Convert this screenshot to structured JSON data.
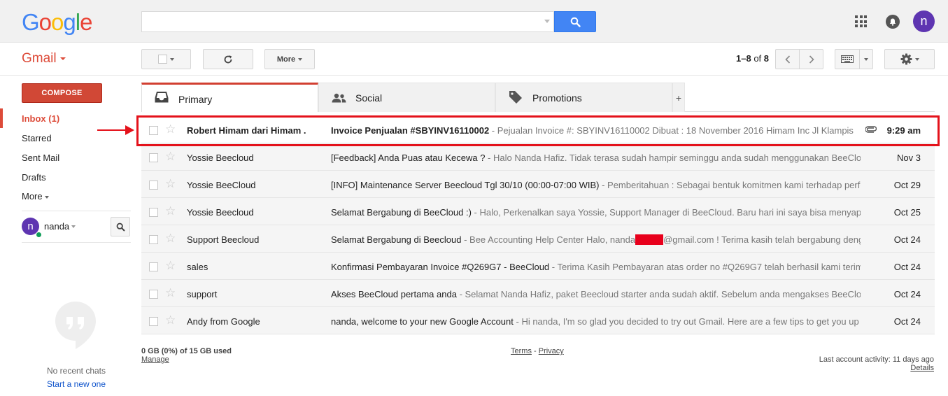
{
  "header": {
    "logo": [
      "G",
      "o",
      "o",
      "g",
      "l",
      "e"
    ],
    "logo_colors": [
      "#4285f4",
      "#ea4335",
      "#fbbc05",
      "#4285f4",
      "#34a853",
      "#ea4335"
    ],
    "search_value": "",
    "avatar_letter": "n"
  },
  "toolbar": {
    "app_label": "Gmail",
    "more_label": "More",
    "paging_range": "1–8",
    "paging_of": "of",
    "paging_total": "8"
  },
  "sidebar": {
    "compose_label": "COMPOSE",
    "items": [
      {
        "label": "Inbox (1)"
      },
      {
        "label": "Starred"
      },
      {
        "label": "Sent Mail"
      },
      {
        "label": "Drafts"
      },
      {
        "label": "More"
      }
    ],
    "me_letter": "n",
    "me_name": "nanda",
    "no_chats": "No recent chats",
    "start_new": "Start a new one"
  },
  "tabs": [
    {
      "label": "Primary",
      "icon": "inbox-icon"
    },
    {
      "label": "Social",
      "icon": "people-icon"
    },
    {
      "label": "Promotions",
      "icon": "tag-icon"
    }
  ],
  "tab_add": "+",
  "emails": [
    {
      "sender": "Robert Himam dari Himam .",
      "subject": "Invoice Penjualan #SBYINV16110002",
      "snippet": " - Pejualan Invoice #: SBYINV16110002 Dibuat : 18 November 2016 Himam Inc Jl Klampis",
      "date": "9:29 am",
      "unread": true,
      "attachment": true
    },
    {
      "sender": "Yossie Beecloud",
      "subject": "[Feedback] Anda Puas atau Kecewa ?",
      "snippet": " - Halo Nanda Hafiz. Tidak terasa sudah hampir seminggu anda sudah menggunakan BeeCloud",
      "date": "Nov 3"
    },
    {
      "sender": "Yossie BeeCloud",
      "subject": "[INFO] Maintenance Server Beecloud Tgl 30/10 (00:00-07:00 WIB)",
      "snippet": " - Pemberitahuan : Sebagai bentuk komitmen kami terhadap performa",
      "date": "Oct 29"
    },
    {
      "sender": "Yossie Beecloud",
      "subject": "Selamat Bergabung di BeeCloud :)",
      "snippet": " - Halo, Perkenalkan saya Yossie, Support Manager di BeeCloud. Baru hari ini saya bisa menyapa",
      "date": "Oct 25"
    },
    {
      "sender": "Support Beecloud",
      "subject": "Selamat Bergabung di Beecloud",
      "snippet": " - Bee Accounting Help Center Halo, nanda",
      "snippet_after": "@gmail.com ! Terima kasih telah bergabung dengan",
      "date": "Oct 24",
      "redacted": true
    },
    {
      "sender": "sales",
      "subject": "Konfirmasi Pembayaran Invoice #Q269G7 - BeeCloud",
      "snippet": " - Terima Kasih Pembayaran atas order no #Q269G7 telah berhasil kami terima",
      "date": "Oct 24"
    },
    {
      "sender": "support",
      "subject": "Akses BeeCloud pertama anda",
      "snippet": " - Selamat Nanda Hafiz, paket Beecloud starter anda sudah aktif. Sebelum anda mengakses BeeCloud",
      "date": "Oct 24"
    },
    {
      "sender": "Andy from Google",
      "subject": "nanda, welcome to your new Google Account",
      "snippet": " - Hi nanda, I'm so glad you decided to try out Gmail. Here are a few tips to get you up",
      "date": "Oct 24"
    }
  ],
  "footer": {
    "storage": "0 GB (0%) of 15 GB used",
    "manage": "Manage",
    "terms": "Terms",
    "sep": " - ",
    "privacy": "Privacy",
    "last_activity": "Last account activity: 11 days ago",
    "details": "Details"
  },
  "colors": {
    "accent_red": "#dd4b39",
    "compose_red": "#d14836",
    "search_blue": "#4285f4",
    "avatar_purple": "#5e35b1",
    "highlight_red": "#e4121b"
  }
}
